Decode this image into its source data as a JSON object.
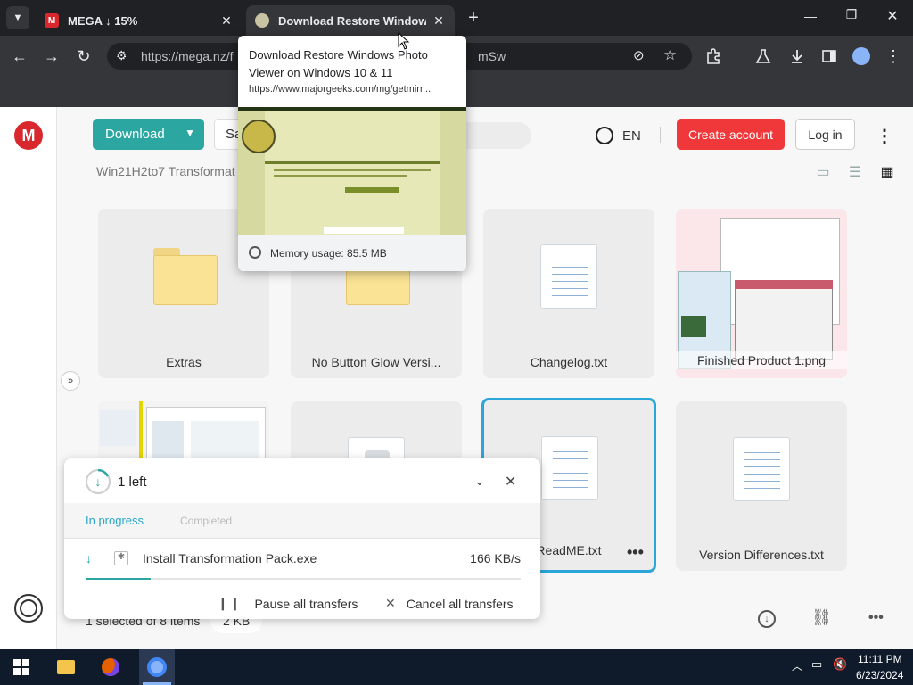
{
  "browser": {
    "tabs": [
      {
        "title": "MEGA ↓ 15%",
        "active": false
      },
      {
        "title": "Download Restore Windows Photo Viewer on Windows 10 & 11",
        "active": true
      }
    ],
    "url": "https://mega.nz/f",
    "url_tail": "mSw",
    "new_tab_label": "+"
  },
  "tooltip": {
    "title": "Download Restore Windows Photo Viewer on Windows 10 & 11",
    "url": "https://www.majorgeeks.com/mg/getmirr...",
    "memory": "Memory usage: 85.5 MB"
  },
  "mega": {
    "download_label": "Download",
    "save_label": "Sa",
    "lang": "EN",
    "create_account_label": "Create account",
    "login_label": "Log in",
    "breadcrumb": "Win21H2to7 Transformat",
    "items": [
      {
        "name": "Extras",
        "kind": "folder"
      },
      {
        "name": "No Button Glow Versi...",
        "kind": "folder"
      },
      {
        "name": "Changelog.txt",
        "kind": "doc"
      },
      {
        "name": "Finished Product 1.png",
        "kind": "image"
      },
      {
        "name": "",
        "kind": "image"
      },
      {
        "name": "",
        "kind": "generic"
      },
      {
        "name": "ReadME.txt",
        "kind": "doc",
        "selected": true
      },
      {
        "name": "Version Differences.txt",
        "kind": "doc"
      }
    ],
    "selection_status": "1 selected of 8 items",
    "selection_size": "2 KB",
    "accent_color": "#2ba6a0",
    "brand_color": "#d9272e"
  },
  "transfer": {
    "count_label": "1 left",
    "tab_in_progress": "In progress",
    "tab_completed": "Completed",
    "file_name": "Install Transformation Pack.exe",
    "speed": "166 KB/s",
    "progress": 0.15,
    "pause_label": "Pause all transfers",
    "cancel_label": "Cancel all transfers"
  },
  "taskbar": {
    "time": "11:11 PM",
    "date": "6/23/2024"
  }
}
